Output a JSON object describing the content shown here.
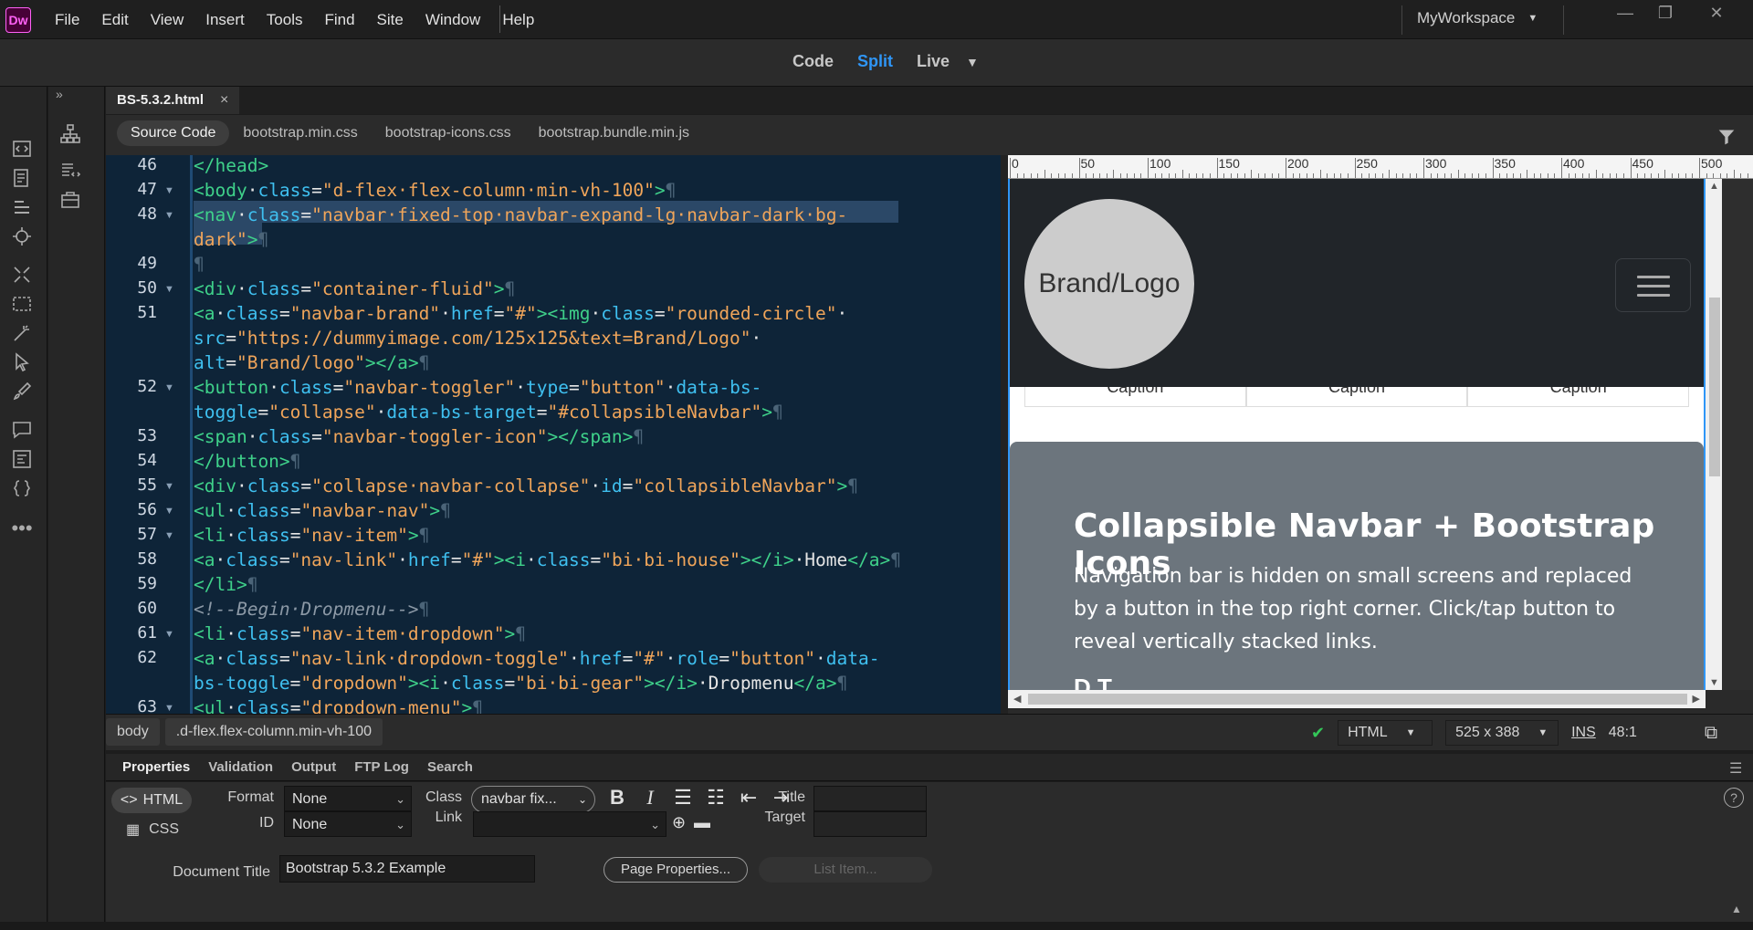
{
  "app": {
    "logo": "Dw"
  },
  "menu": [
    "File",
    "Edit",
    "View",
    "Insert",
    "Tools",
    "Find",
    "Site",
    "Window",
    "Help"
  ],
  "workspace": {
    "label": "MyWorkspace"
  },
  "window_controls": {
    "minimize": "—",
    "restore": "❐",
    "close": "✕"
  },
  "view_modes": {
    "code": "Code",
    "split": "Split",
    "live": "Live",
    "active": "Split"
  },
  "document": {
    "tab_label": "BS-5.3.2.html",
    "close": "×"
  },
  "related_files": [
    "Source Code",
    "bootstrap.min.css",
    "bootstrap-icons.css",
    "bootstrap.bundle.min.js"
  ],
  "code": {
    "line_numbers": [
      "46",
      "47",
      "48",
      "49",
      "50",
      "51",
      "52",
      "53",
      "54",
      "55",
      "56",
      "57",
      "58",
      "59",
      "60",
      "61",
      "62",
      "63"
    ]
  },
  "ruler": [
    "0",
    "50",
    "100",
    "150",
    "200",
    "250",
    "300",
    "350",
    "400",
    "450",
    "500"
  ],
  "live": {
    "brand_logo_text": "Brand/Logo",
    "caption_cells": [
      "Caption",
      "Caption",
      "Caption"
    ],
    "jumbotron_title": "Collapsible Navbar + Bootstrap Icons",
    "jumbotron_text": "Navigation bar is hidden on small screens and replaced by a button in the top right corner. Click/tap button to reveal vertically stacked links.",
    "jumbotron_cut": "D    T"
  },
  "status": {
    "tag_path": [
      "body",
      ".d-flex.flex-column.min-vh-100"
    ],
    "language": "HTML",
    "dimensions": "525 x 388",
    "insert_mode": "INS",
    "cursor": "48:1"
  },
  "properties": {
    "tabs": [
      "Properties",
      "Validation",
      "Output",
      "FTP Log",
      "Search"
    ],
    "html_btn": "HTML",
    "css_btn": "CSS",
    "format_label": "Format",
    "format_value": "None",
    "id_label": "ID",
    "id_value": "None",
    "class_label": "Class",
    "class_value": "navbar fix...",
    "link_label": "Link",
    "link_value": "",
    "title_label": "Title",
    "target_label": "Target",
    "doc_title_label": "Document Title",
    "doc_title_value": "Bootstrap 5.3.2 Example",
    "page_properties_btn": "Page Properties...",
    "list_item_btn": "List Item..."
  },
  "colors": {
    "accent": "#2f96f7",
    "code_bg": "#0e2438",
    "tag": "#3fd18a",
    "attr": "#3fc0f0",
    "string": "#f0a55a"
  }
}
